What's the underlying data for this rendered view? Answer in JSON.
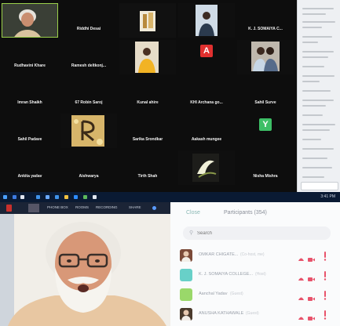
{
  "gallery": {
    "tiles": [
      {
        "name": "",
        "type": "video-elder"
      },
      {
        "name": "Riddhi Desai",
        "type": "name"
      },
      {
        "name": "",
        "type": "video-figure"
      },
      {
        "name": "",
        "type": "video-person"
      },
      {
        "name": "K. J. SOMAIYA C...",
        "type": "name"
      },
      {
        "name": "Rudhavini Khare",
        "type": "name"
      },
      {
        "name": "Ramesh deltkonj...",
        "type": "name"
      },
      {
        "name": "",
        "type": "video-yellow"
      },
      {
        "name": "",
        "type": "avatar",
        "letter": "A",
        "color": "#e0302f"
      },
      {
        "name": "",
        "type": "video-group"
      },
      {
        "name": "Imran Shaikh",
        "type": "name"
      },
      {
        "name": "67 Robin Saroj",
        "type": "name"
      },
      {
        "name": "Kunal ahire",
        "type": "name"
      },
      {
        "name": "KHI Archana go...",
        "type": "name"
      },
      {
        "name": "Sahil Surve",
        "type": "name"
      },
      {
        "name": "Sahil Padave",
        "type": "name"
      },
      {
        "name": "",
        "type": "image-r"
      },
      {
        "name": "Sarika Srondkar",
        "type": "name"
      },
      {
        "name": "Aakash mungee",
        "type": "name"
      },
      {
        "name": "",
        "type": "avatar",
        "letter": "Y",
        "color": "#3dbf66"
      },
      {
        "name": "Ankita yadav",
        "type": "name"
      },
      {
        "name": "Aishwarya",
        "type": "name"
      },
      {
        "name": "Tirth Shah",
        "type": "name"
      },
      {
        "name": "",
        "type": "video-plant"
      },
      {
        "name": "Nisha Mishra",
        "type": "name"
      }
    ]
  },
  "taskbar": {
    "clock": "3:41 PM"
  },
  "speaker": {
    "bar_items": [
      "PHONE BOX",
      "ROOMS",
      "RECORDING",
      "SHARE"
    ]
  },
  "participants": {
    "close_label": "Close",
    "title": "Participants (354)",
    "search_placeholder": "Search",
    "rows": [
      {
        "name": "OMKAR CHIGATE...",
        "host": "(Co-host, me)",
        "avatar_color": "#7b4a38",
        "avatar_kind": "photo"
      },
      {
        "name": "K. J. SOMAIYA COLLEGE...",
        "host": "(Host)",
        "avatar_color": "#68d0c8",
        "avatar_kind": "plain"
      },
      {
        "name": "Aanchal Yadav",
        "host": "(Guest)",
        "avatar_color": "#9ad86a",
        "avatar_kind": "plain"
      },
      {
        "name": "ANUSHA KATHAWALE",
        "host": "(Guest)",
        "avatar_color": "#4a3a2c",
        "avatar_kind": "photo"
      }
    ]
  },
  "colors": {
    "gallery_bg": "#0d0d0d",
    "taskbar": "#0a1a33",
    "mic_muted": "#e8536b",
    "accent_teal": "#8bb8b5"
  }
}
